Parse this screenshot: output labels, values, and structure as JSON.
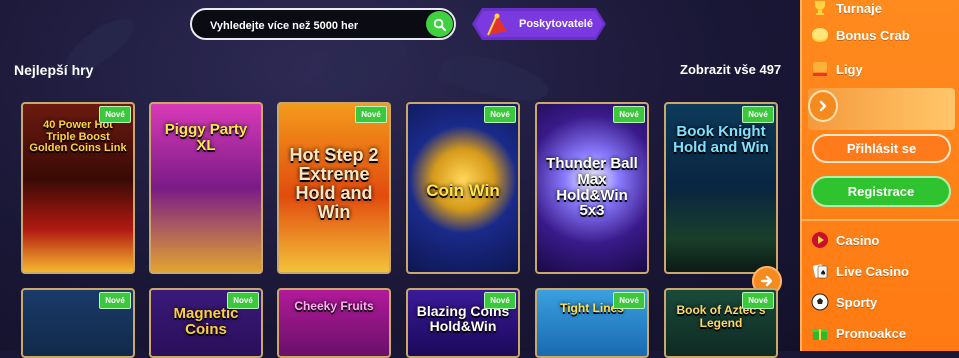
{
  "search": {
    "placeholder": "Vyhledejte více než 5000 her"
  },
  "providers_button": {
    "label": "Poskytovatelé"
  },
  "section": {
    "title": "Nejlepší hry",
    "show_all": "Zobrazit vše 497"
  },
  "badge_new": "Nové",
  "games_row1": [
    {
      "title": "40 Power Hot Triple Boost Golden Coins Link",
      "new": true
    },
    {
      "title": "Piggy Party XL",
      "new": false
    },
    {
      "title": "Hot Step 2 Extreme Hold and Win",
      "new": true
    },
    {
      "title": "Coin Win",
      "new": true
    },
    {
      "title": "Thunder Ball Max Hold&Win 5x3",
      "new": true
    },
    {
      "title": "Book Knight Hold and Win",
      "new": true
    }
  ],
  "games_row2": [
    {
      "title": "",
      "new": true
    },
    {
      "title": "Magnetic Coins",
      "new": true
    },
    {
      "title": "Cheeky Fruits",
      "new": false
    },
    {
      "title": "Blazing Coins Hold&Win",
      "new": true
    },
    {
      "title": "Tight Lines",
      "new": true
    },
    {
      "title": "Book of Aztec's Legend",
      "new": true
    }
  ],
  "sidebar": {
    "top_items": [
      {
        "label": "Turnaje",
        "icon": "trophy-icon"
      },
      {
        "label": "Bonus Crab",
        "icon": "coin-icon"
      },
      {
        "label": "Ligy",
        "icon": "league-icon"
      }
    ],
    "login": "Přihlásit se",
    "register": "Registrace",
    "nav_items": [
      {
        "label": "Casino",
        "icon": "play-icon"
      },
      {
        "label": "Live Casino",
        "icon": "cards-icon"
      },
      {
        "label": "Sporty",
        "icon": "ball-icon"
      },
      {
        "label": "Promoakce",
        "icon": "gift-icon"
      }
    ]
  },
  "colors": {
    "accent_orange": "#ff7a12",
    "accent_green": "#3fd13f",
    "accent_purple": "#7b3ae0",
    "background": "#1a1636"
  }
}
